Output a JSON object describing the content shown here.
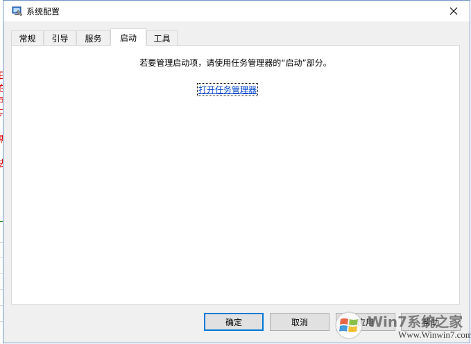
{
  "window": {
    "title": "系统配置"
  },
  "tabs": [
    {
      "label": "常规",
      "active": false
    },
    {
      "label": "引导",
      "active": false
    },
    {
      "label": "服务",
      "active": false
    },
    {
      "label": "启动",
      "active": true
    },
    {
      "label": "工具",
      "active": false
    }
  ],
  "startup": {
    "instruction": "若要管理启动项，请使用任务管理器的“启动”部分。",
    "open_task_manager_link": "打开任务管理器"
  },
  "buttons": {
    "ok": "确定",
    "cancel": "取消",
    "apply": "应用",
    "help": "帮助"
  },
  "watermark": {
    "brand": "Win7系统之家",
    "url": "Www.Winwin7.com"
  },
  "icons": {
    "app": "msconfig-icon",
    "close": "close-icon",
    "watermark_logo": "windows-logo-icon"
  },
  "colors": {
    "accent": "#0078d7",
    "link": "#0044cc",
    "window_border": "#6f95c9"
  }
}
